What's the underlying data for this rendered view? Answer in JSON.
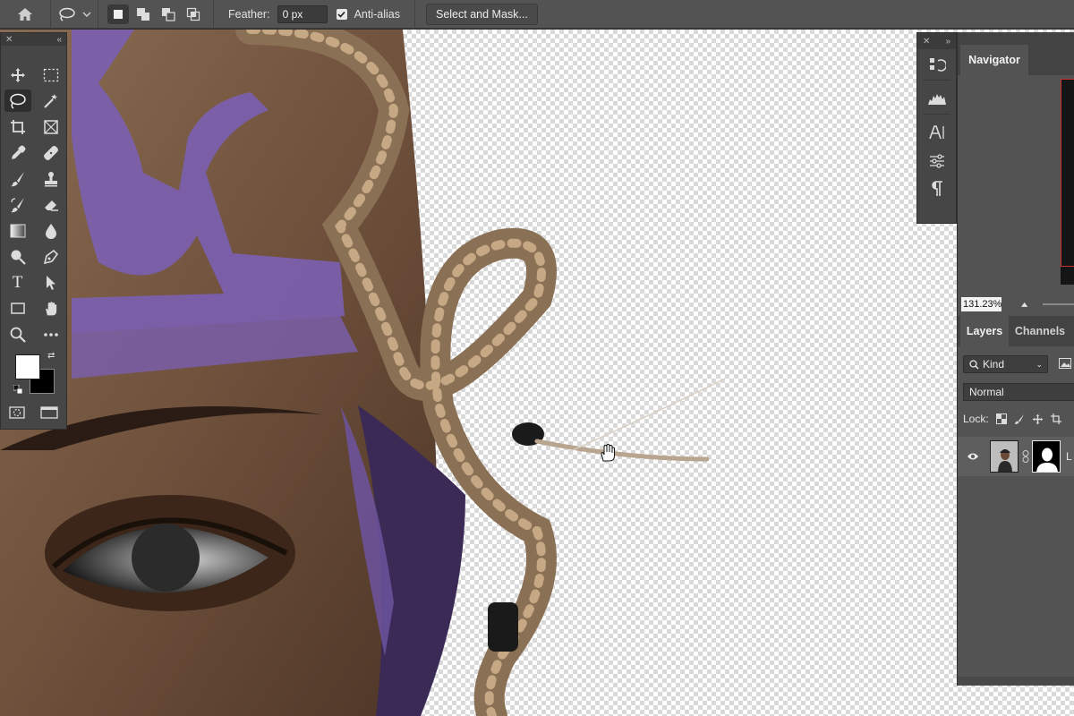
{
  "options_bar": {
    "home_icon": "home-icon",
    "tool_icon": "lasso-icon",
    "feather_label": "Feather:",
    "feather_value": "0 px",
    "antialias_label": "Anti-alias",
    "antialias_checked": true,
    "select_mask_label": "Select and Mask..."
  },
  "tools_panel": {
    "tools": [
      "move-icon",
      "rectangular-marquee-icon",
      "lasso-icon",
      "magic-wand-icon",
      "crop-icon",
      "frame-icon",
      "eyedropper-icon",
      "healing-brush-icon",
      "brush-icon",
      "clone-stamp-icon",
      "history-brush-icon",
      "eraser-icon",
      "gradient-icon",
      "blur-icon",
      "dodge-icon",
      "pen-icon",
      "type-icon",
      "path-selection-icon",
      "rectangle-icon",
      "hand-icon",
      "zoom-icon",
      "more-tools-icon"
    ],
    "active_tool": "lasso-icon",
    "type_tool_glyph": "T",
    "foreground_color": "#ffffff",
    "background_color": "#000000"
  },
  "navigator": {
    "tab_label": "Navigator",
    "zoom_value": "131.23%"
  },
  "layers": {
    "tab_layers": "Layers",
    "tab_channels": "Channels",
    "kind_label": "Kind",
    "blend_mode": "Normal",
    "lock_label": "Lock:",
    "layer_name": "L"
  },
  "accent_colors": {
    "panel_bg": "#535353",
    "toolbar_bg": "#464646",
    "face_paint": "#7b5fb0"
  }
}
